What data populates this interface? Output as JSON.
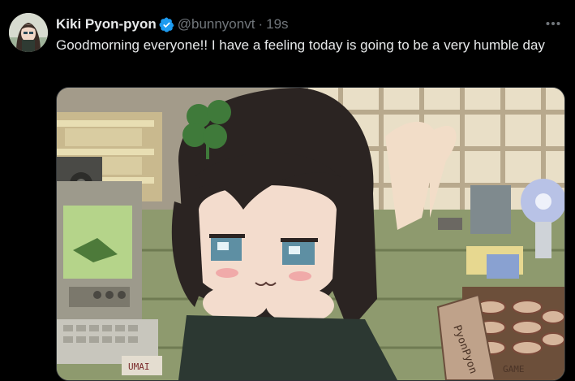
{
  "post": {
    "display_name": "Kiki Pyon-pyon",
    "handle": "@bunnyonvt",
    "separator": "·",
    "timestamp": "19s",
    "text": "Goodmorning everyone!! I have a feeling today is going to be a very humble day",
    "verified": true,
    "more_icon": "more-horizontal-icon",
    "avatar_icon": "avatar"
  },
  "media": {
    "description_icon": "pixel-art-image",
    "sign_text_1": "UMAI",
    "sign_text_2": "PyonPyon",
    "sign_text_3": "GAME"
  },
  "colors": {
    "background": "#000000",
    "text": "#e7e9ea",
    "secondary_text": "#71767b",
    "verified_blue": "#1d9bf0"
  }
}
